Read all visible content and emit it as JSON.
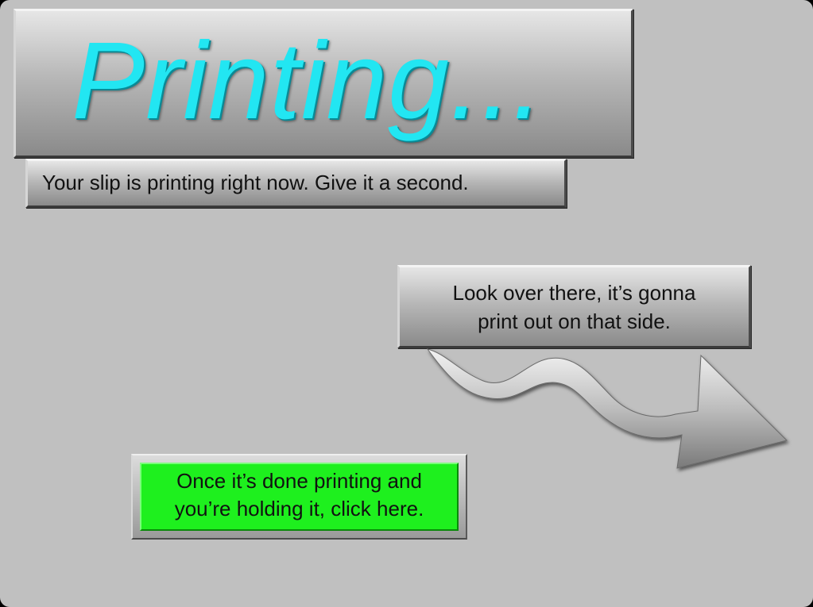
{
  "title": "Printing...",
  "subtitle": "Your slip is printing right now. Give it a second.",
  "direction_hint": {
    "line1": "Look over there, it’s gonna",
    "line2": "print out on that side."
  },
  "done_button": {
    "line1": "Once it’s done printing and",
    "line2": "you’re holding it, click here."
  },
  "icons": {
    "arrow": "curvy-arrow-right-icon"
  },
  "colors": {
    "background": "#c0c0c0",
    "title": "#22e6f2",
    "button_green": "#1ef01e"
  }
}
